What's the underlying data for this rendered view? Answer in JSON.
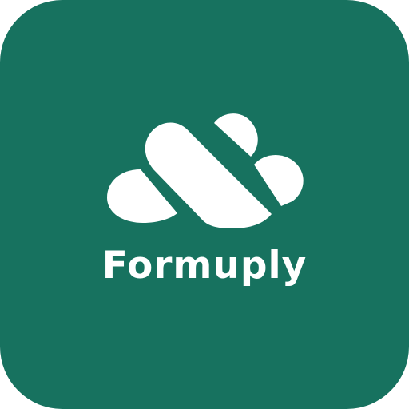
{
  "app": {
    "brand_name": "Formuply",
    "logo_icon": "formuply-logo-icon"
  },
  "colors": {
    "background": "#17725f",
    "foreground": "#ffffff"
  }
}
